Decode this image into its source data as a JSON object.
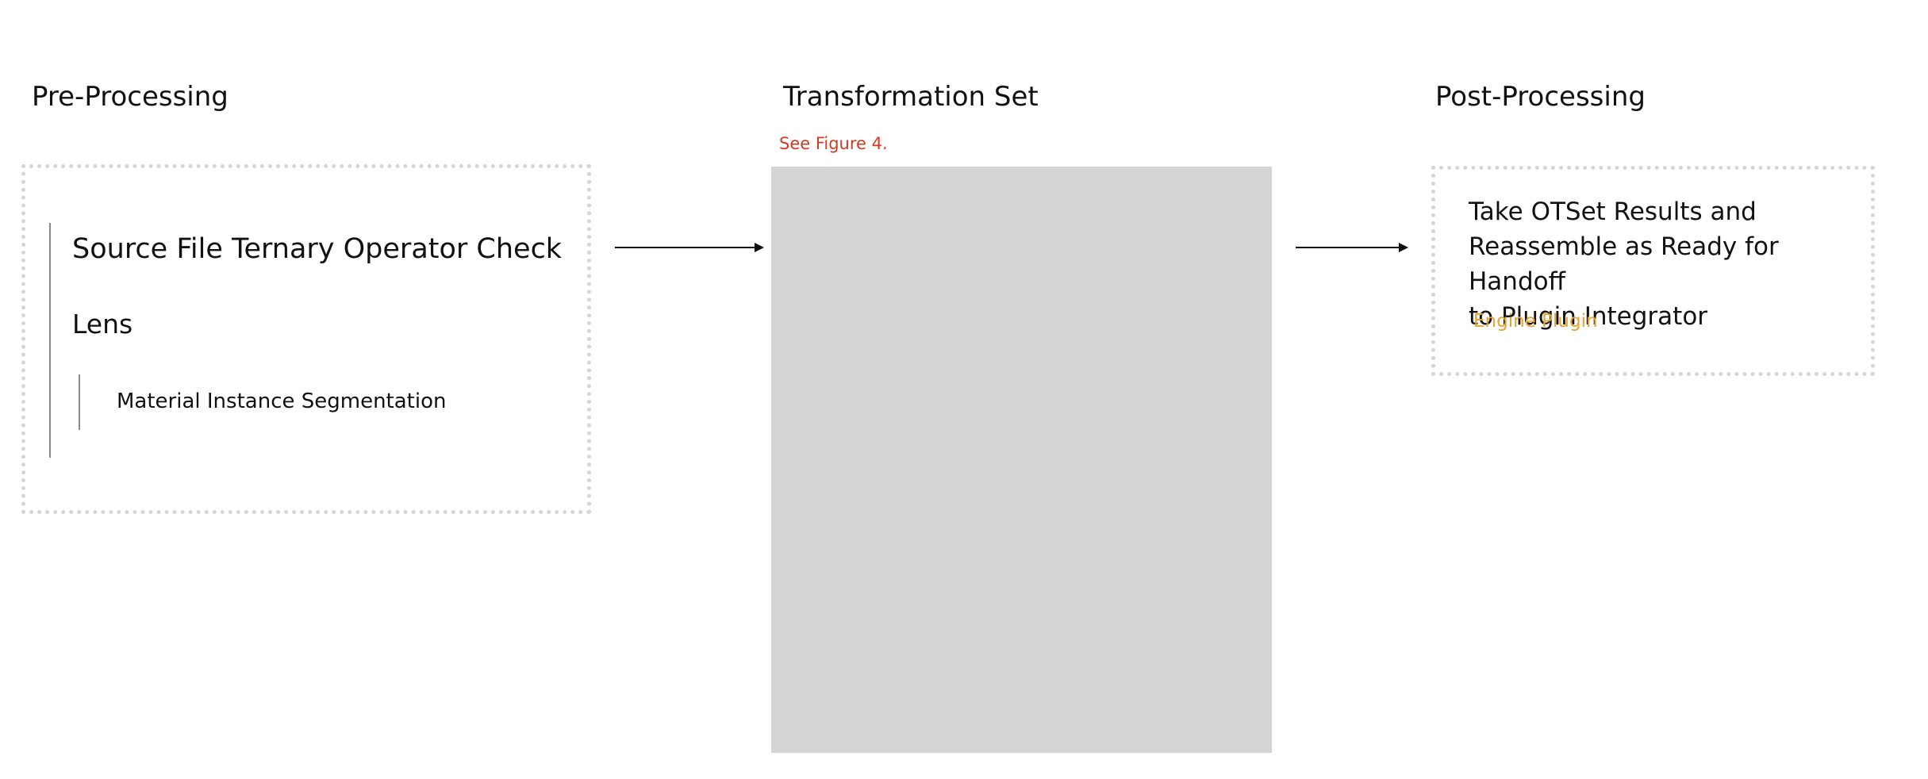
{
  "sections": {
    "pre_processing": {
      "title": "Pre-Processing",
      "steps": {
        "source_check": "Source File Ternary Operator Check",
        "lens": "Lens",
        "material_segmentation": "Material Instance Segmentation"
      }
    },
    "transformation_set": {
      "title": "Transformation Set",
      "figure_ref": "See Figure 4."
    },
    "post_processing": {
      "title": "Post-Processing",
      "description": "Take OTSet Results and\nReassemble as Ready for Handoff\nto Plugin Integrator",
      "tag": "Engine Plugin"
    }
  },
  "colors": {
    "figure_ref": "#d33a22",
    "tag": "#e9a330",
    "placeholder_fill": "#d4d4d4",
    "dotted_border": "#d6d6d6"
  }
}
